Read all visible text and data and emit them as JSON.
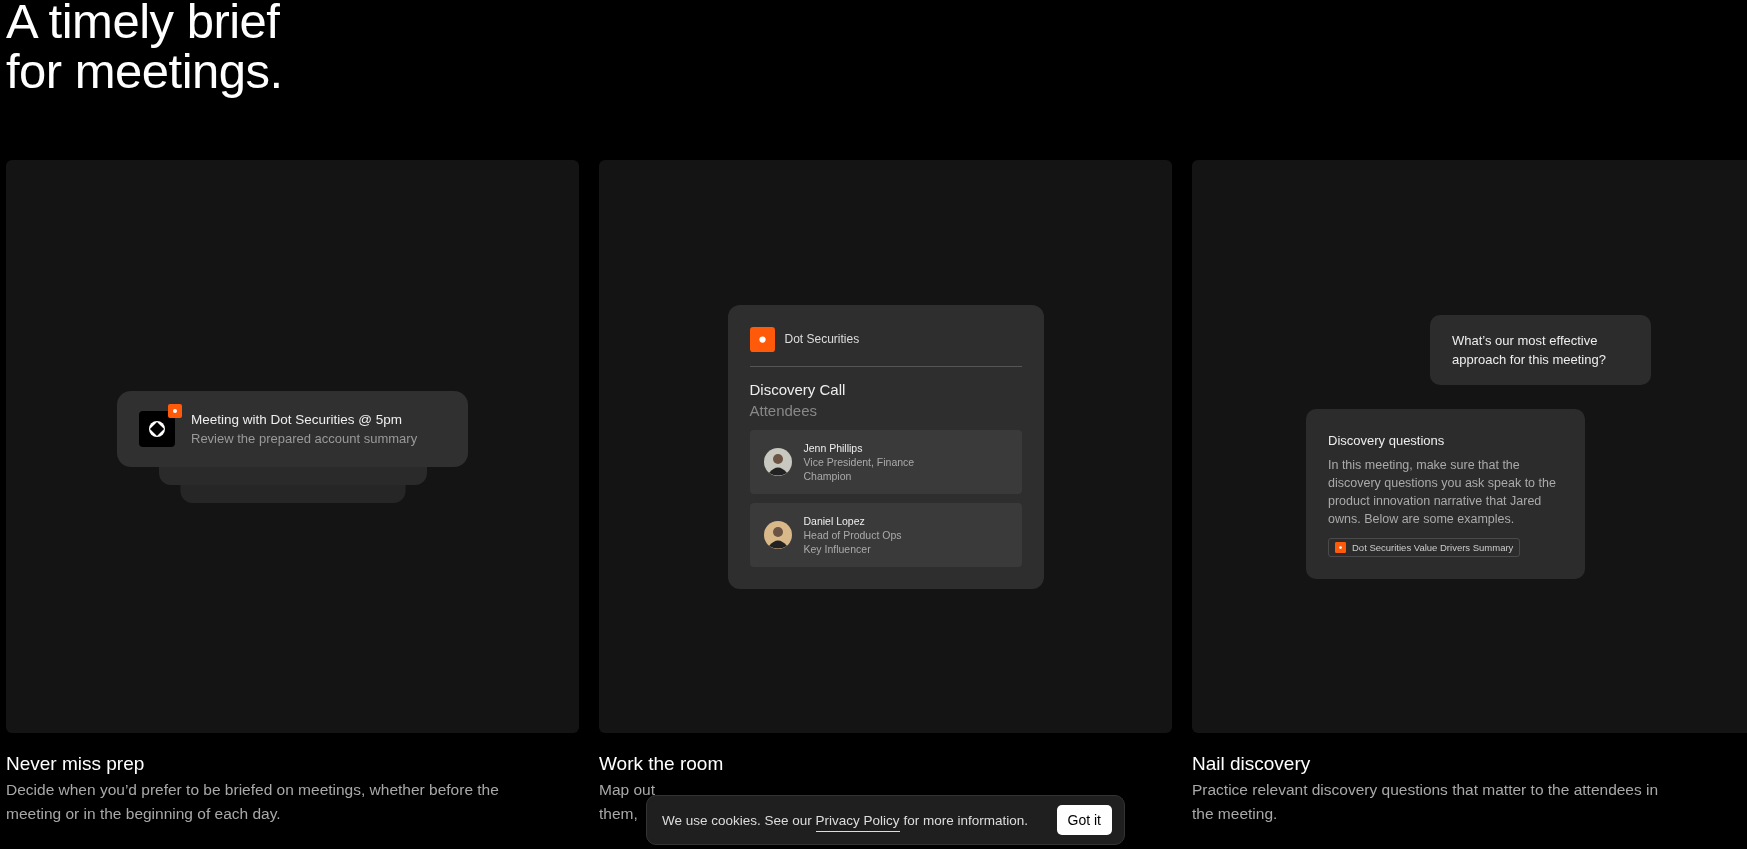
{
  "heading": [
    "A timely brief",
    "for meetings."
  ],
  "features": [
    {
      "title": "Never miss prep",
      "description": [
        "Decide when you’d prefer to be briefed on meetings, whether before the",
        "meeting or in the beginning of each day."
      ],
      "illustration": {
        "kind": "notification",
        "title": "Meeting with Dot Securities @ 5pm",
        "subtitle": "Review the prepared account summary"
      }
    },
    {
      "title": "Work the room",
      "description": [
        "Map out",
        "them,"
      ],
      "illustration": {
        "kind": "attendees",
        "company": "Dot Securities",
        "meeting": "Discovery Call",
        "section": "Attendees",
        "people": [
          {
            "name": "Jenn Phillips",
            "role": "Vice President, Finance",
            "tag": "Champion"
          },
          {
            "name": "Daniel Lopez",
            "role": "Head of Product Ops",
            "tag": "Key Influencer"
          }
        ]
      }
    },
    {
      "title": "Nail discovery",
      "description": [
        "Practice relevant discovery questions that matter to the attendees in",
        "the meeting."
      ],
      "illustration": {
        "kind": "chat",
        "question": "What’s our most effective approach for this meeting?",
        "answer_title": "Discovery questions",
        "answer": "In this meeting, make sure that the discovery questions you ask speak to the product innovation narrative that Jared owns. Below are some examples.",
        "source": "Dot Securities Value Drivers Summary"
      }
    }
  ],
  "cookie_banner": {
    "text_before": "We use cookies. See our ",
    "link": "Privacy Policy",
    "text_after": " for more information.",
    "button": "Got it"
  }
}
